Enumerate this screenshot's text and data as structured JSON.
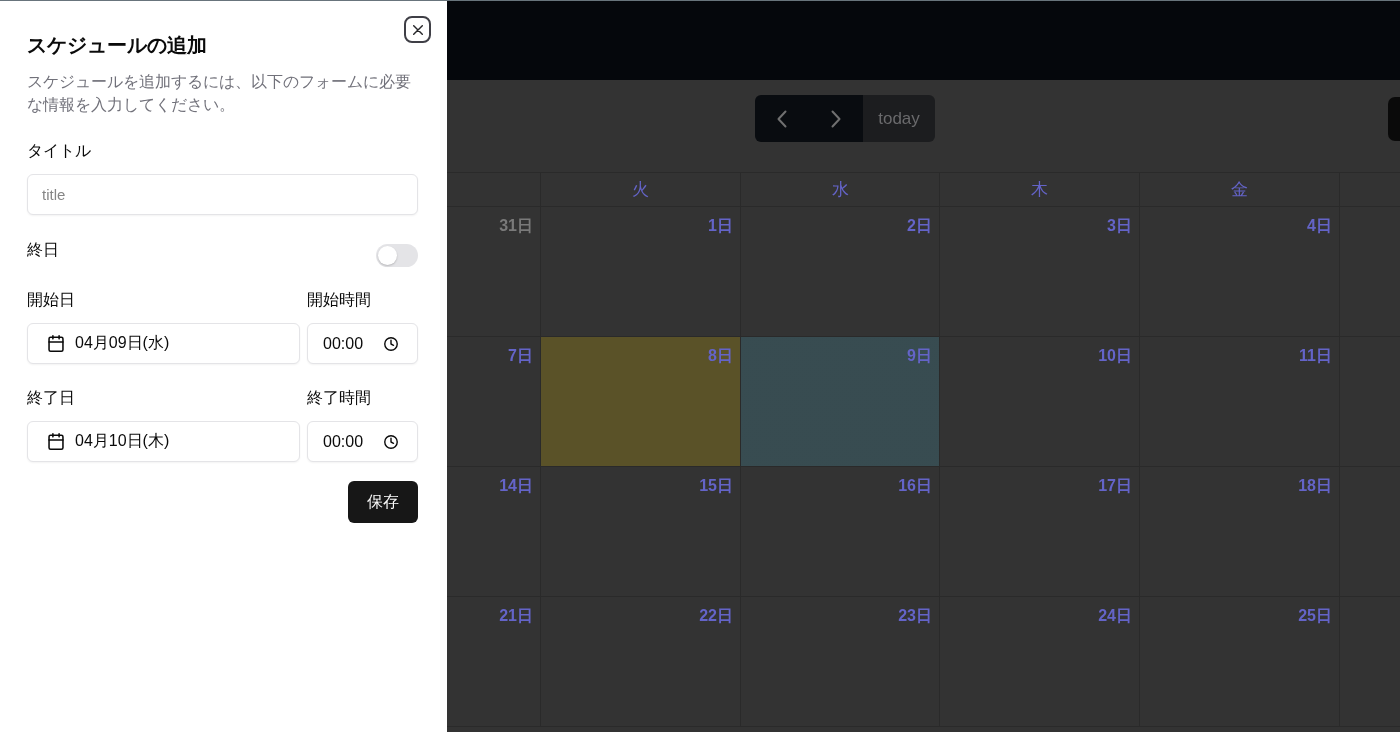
{
  "form": {
    "title": "スケジュールの追加",
    "description": "スケジュールを追加するには、以下のフォームに必要な情報を入力してください。",
    "title_field": {
      "label": "タイトル",
      "placeholder": "title"
    },
    "all_day": {
      "label": "終日",
      "on": false
    },
    "date_rows": [
      {
        "date_label": "開始日",
        "date": "04月09日(水)",
        "time_label": "開始時間",
        "time": "00:00"
      },
      {
        "date_label": "終了日",
        "date": "04月10日(木)",
        "time_label": "終了時間",
        "time": "00:00"
      }
    ],
    "save_button": "保存"
  },
  "calendar": {
    "nav_buttons": [
      {
        "kind": "prev",
        "disabled": false
      },
      {
        "kind": "next",
        "disabled": false
      },
      {
        "kind": "today",
        "label": "today",
        "disabled": true
      }
    ],
    "weekdays": [
      "火",
      "水",
      "木",
      "金"
    ],
    "weeks": [
      {
        "days": [
          {
            "label": "31日",
            "other_month": true,
            "today": false,
            "selected": false
          },
          {
            "label": "1日",
            "other_month": false,
            "today": false,
            "selected": false
          },
          {
            "label": "2日",
            "other_month": false,
            "today": false,
            "selected": false
          },
          {
            "label": "3日",
            "other_month": false,
            "today": false,
            "selected": false
          },
          {
            "label": "4日",
            "other_month": false,
            "today": false,
            "selected": false
          }
        ]
      },
      {
        "days": [
          {
            "label": "7日",
            "other_month": false,
            "today": false,
            "selected": false
          },
          {
            "label": "8日",
            "other_month": false,
            "today": true,
            "selected": false
          },
          {
            "label": "9日",
            "other_month": false,
            "today": false,
            "selected": true
          },
          {
            "label": "10日",
            "other_month": false,
            "today": false,
            "selected": false
          },
          {
            "label": "11日",
            "other_month": false,
            "today": false,
            "selected": false
          }
        ]
      },
      {
        "days": [
          {
            "label": "14日",
            "other_month": false,
            "today": false,
            "selected": false
          },
          {
            "label": "15日",
            "other_month": false,
            "today": false,
            "selected": false
          },
          {
            "label": "16日",
            "other_month": false,
            "today": false,
            "selected": false
          },
          {
            "label": "17日",
            "other_month": false,
            "today": false,
            "selected": false
          },
          {
            "label": "18日",
            "other_month": false,
            "today": false,
            "selected": false
          }
        ]
      },
      {
        "days": [
          {
            "label": "21日",
            "other_month": false,
            "today": false,
            "selected": false
          },
          {
            "label": "22日",
            "other_month": false,
            "today": false,
            "selected": false
          },
          {
            "label": "23日",
            "other_month": false,
            "today": false,
            "selected": false
          },
          {
            "label": "24日",
            "other_month": false,
            "today": false,
            "selected": false
          },
          {
            "label": "25日",
            "other_month": false,
            "today": false,
            "selected": false
          }
        ]
      }
    ]
  }
}
